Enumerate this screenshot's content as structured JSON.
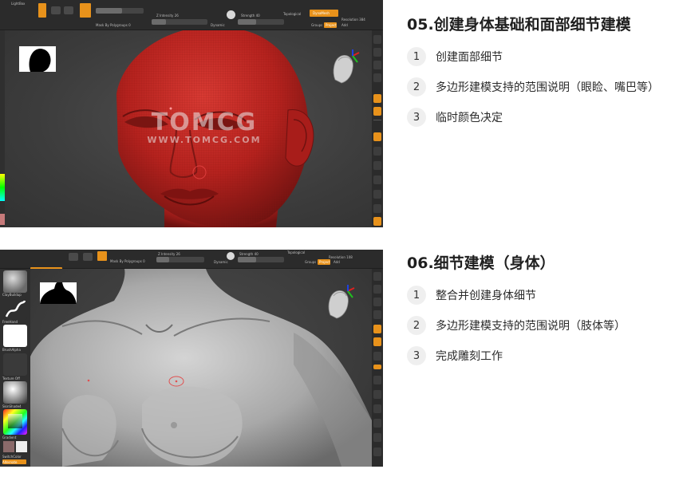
{
  "colors": {
    "accent_orange": "#e8921b",
    "mesh_red": "#b5221e",
    "panel_dark": "#2b2b2b",
    "canvas_gray": "#3a3a3a"
  },
  "watermark": {
    "main": "TOMCG",
    "sub": "WWW.TOMCG.COM"
  },
  "shot1_ui": {
    "lightbox": "LightBox",
    "intensity": "Z Intensity 26",
    "strength": "Strength 40",
    "topological": "Topological",
    "dynamesh": "DynaMesh",
    "resolution": "Resolution 384",
    "mask_label": "Mask By Polygroups 0",
    "dynamic": "Dynamic",
    "groups": "Groups",
    "project": "Project",
    "add": "Add"
  },
  "shot2_ui": {
    "intensity": "Z Intensity 26",
    "strength": "Strength 40",
    "topological": "Topological",
    "resolution": "Resolution 108",
    "mask_label": "Mask By Polygroups 0",
    "dynamic": "Dynamic",
    "groups": "Groups",
    "project": "Project",
    "add": "Add",
    "tools": [
      {
        "label": "ClayBuildup"
      },
      {
        "label": "FreeHand"
      },
      {
        "label": "BrushAlpha"
      },
      {
        "label": "Texture Off"
      },
      {
        "label": "SkinShade4"
      },
      {
        "label": "Gradient"
      },
      {
        "label": "SwitchColor"
      },
      {
        "label": "Alternate"
      }
    ]
  },
  "sections": [
    {
      "title": "05.创建身体基础和面部细节建模",
      "items": [
        {
          "num": "1",
          "text": "创建面部细节"
        },
        {
          "num": "2",
          "text": "多边形建模支持的范围说明（眼睑、嘴巴等）"
        },
        {
          "num": "3",
          "text": "临时颜色决定"
        }
      ]
    },
    {
      "title": "06.细节建模（身体）",
      "items": [
        {
          "num": "1",
          "text": "整合并创建身体细节"
        },
        {
          "num": "2",
          "text": "多边形建模支持的范围说明（肢体等）"
        },
        {
          "num": "3",
          "text": "完成雕刻工作"
        }
      ]
    }
  ]
}
